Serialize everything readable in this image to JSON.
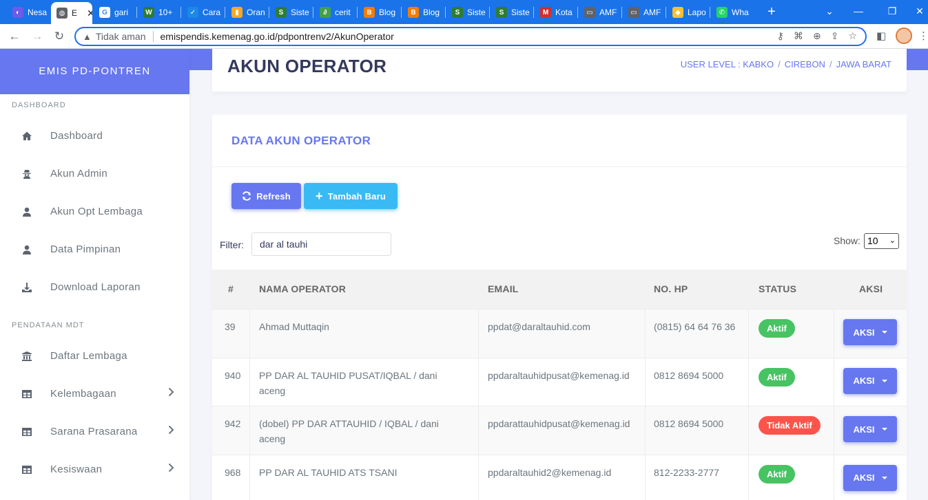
{
  "browser": {
    "tabs": [
      {
        "label": "Nesa",
        "color": "#6c5ce7",
        "glyph": "◐"
      },
      {
        "label": "E",
        "color": "#5f6368",
        "glyph": "◍",
        "active": true
      },
      {
        "label": "gari",
        "color": "#ffffff",
        "glyph": "G"
      },
      {
        "label": "10+",
        "color": "#2e7d32",
        "glyph": "W"
      },
      {
        "label": "Cara",
        "color": "#1e88e5",
        "glyph": "✓"
      },
      {
        "label": "Oran",
        "color": "#f9a825",
        "glyph": "▮"
      },
      {
        "label": "Siste",
        "color": "#2e7d32",
        "glyph": "S"
      },
      {
        "label": "cerit",
        "color": "#43a047",
        "glyph": "∂"
      },
      {
        "label": "Blog",
        "color": "#f57c00",
        "glyph": "B"
      },
      {
        "label": "Blog",
        "color": "#f57c00",
        "glyph": "B"
      },
      {
        "label": "Siste",
        "color": "#2e7d32",
        "glyph": "S"
      },
      {
        "label": "Siste",
        "color": "#2e7d32",
        "glyph": "S"
      },
      {
        "label": "Kota",
        "color": "#d32f2f",
        "glyph": "M"
      },
      {
        "label": "AMF",
        "color": "#5f6368",
        "glyph": "▭"
      },
      {
        "label": "AMF",
        "color": "#5f6368",
        "glyph": "▭"
      },
      {
        "label": "Lapo",
        "color": "#fbc02d",
        "glyph": "◆"
      },
      {
        "label": "Wha",
        "color": "#25d366",
        "glyph": "✆"
      }
    ],
    "security_label": "Tidak aman",
    "url": "emispendis.kemenag.go.id/pdpontrenv2/AkunOperator"
  },
  "sidebar": {
    "brand": "EMIS PD-PONTREN",
    "sections": [
      {
        "header": "DASHBOARD",
        "items": [
          {
            "label": "Dashboard",
            "icon": "home-icon"
          },
          {
            "label": "Akun Admin",
            "icon": "user-secret-icon"
          },
          {
            "label": "Akun Opt Lembaga",
            "icon": "user-icon"
          },
          {
            "label": "Data Pimpinan",
            "icon": "user-icon"
          },
          {
            "label": "Download Laporan",
            "icon": "download-icon"
          }
        ]
      },
      {
        "header": "PENDATAAN MDT",
        "items": [
          {
            "label": "Daftar Lembaga",
            "icon": "institution-icon"
          },
          {
            "label": "Kelembagaan",
            "icon": "table-icon",
            "chevron": true
          },
          {
            "label": "Sarana Prasarana",
            "icon": "table-icon",
            "chevron": true
          },
          {
            "label": "Kesiswaan",
            "icon": "table-icon",
            "chevron": true
          }
        ]
      }
    ]
  },
  "header": {
    "title": "AKUN OPERATOR",
    "breadcrumbs": [
      "USER LEVEL : KABKO",
      "CIREBON",
      "JAWA BARAT"
    ]
  },
  "card": {
    "title": "DATA AKUN OPERATOR",
    "refresh_label": "Refresh",
    "add_label": "Tambah Baru",
    "filter_label": "Filter:",
    "filter_value": "dar al tauhi",
    "show_label": "Show:",
    "show_value": "10"
  },
  "table": {
    "columns": [
      "#",
      "NAMA OPERATOR",
      "EMAIL",
      "NO. HP",
      "STATUS",
      "AKSI"
    ],
    "rows": [
      {
        "id": "39",
        "name": "Ahmad Muttaqin",
        "email": "ppdat@daraltauhid.com",
        "phone": "(0815) 64 64 76 36",
        "status": "Aktif",
        "active": true,
        "action": "AKSI"
      },
      {
        "id": "940",
        "name": "PP DAR AL TAUHID PUSAT/IQBAL / dani aceng",
        "email": "ppdaraltauhidpusat@kemenag.id",
        "phone": "0812 8694 5000",
        "status": "Aktif",
        "active": true,
        "action": "AKSI"
      },
      {
        "id": "942",
        "name": "(dobel) PP DAR ATTAUHID / IQBAL / dani aceng",
        "email": "ppdarattauhidpusat@kemenag.id",
        "phone": "0812 8694 5000",
        "status": "Tidak Aktif",
        "active": false,
        "action": "AKSI"
      },
      {
        "id": "968",
        "name": "PP DAR AL TAUHID ATS TSANI",
        "email": "ppdaraltauhid2@kemenag.id",
        "phone": "812-2233-2777",
        "status": "Aktif",
        "active": true,
        "action": "AKSI"
      }
    ]
  }
}
